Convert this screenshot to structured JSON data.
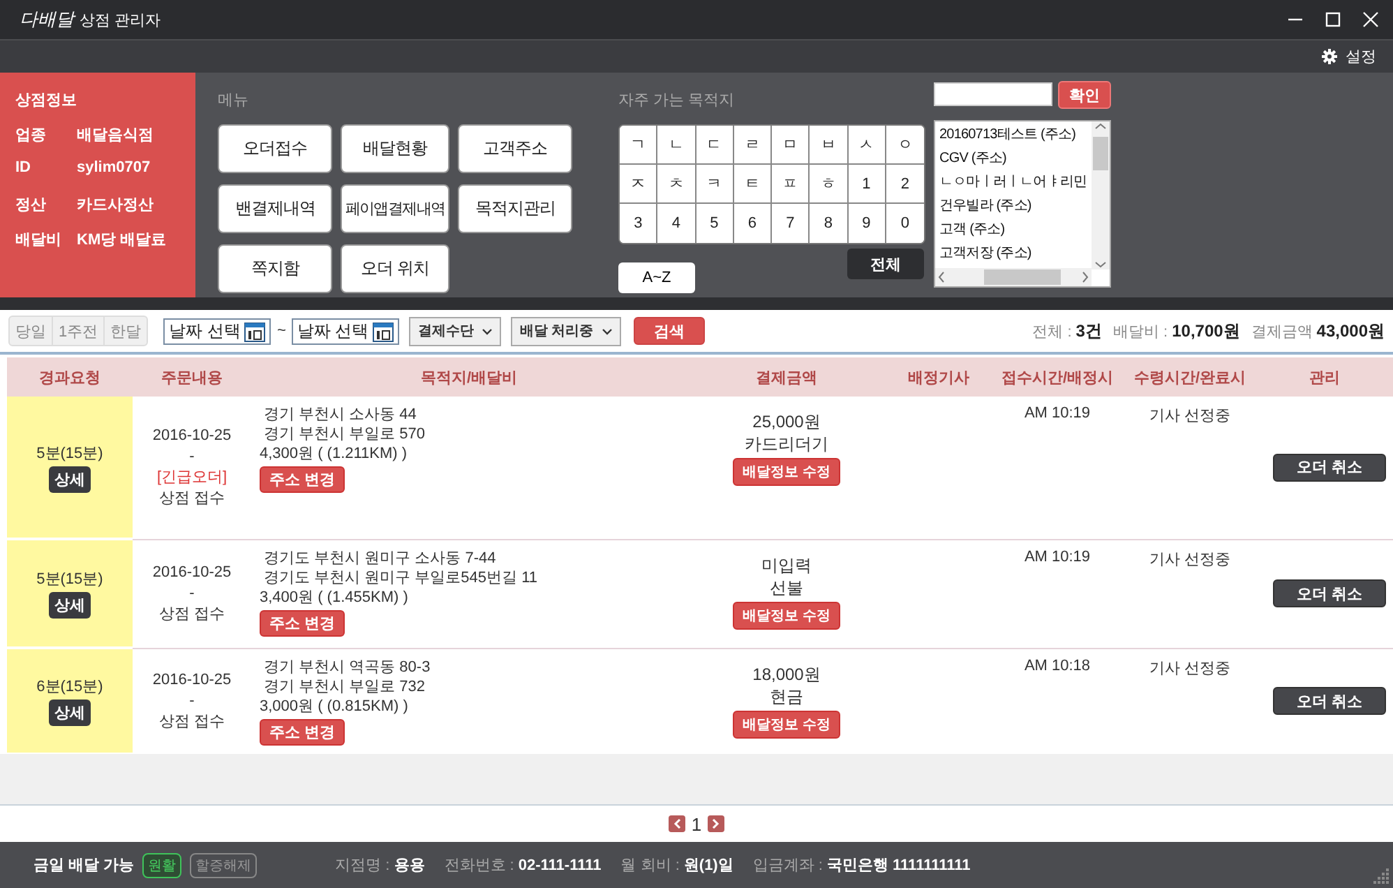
{
  "window": {
    "logo": "다배달",
    "title": "상점 관리자"
  },
  "toolbar": {
    "settings": "설정"
  },
  "store_info": {
    "title": "상점정보",
    "fields": [
      {
        "label": "업종",
        "value": "배달음식점"
      },
      {
        "label": "ID",
        "value": "sylim0707"
      },
      {
        "label": "정산",
        "value": "카드사정산"
      },
      {
        "label": "배달비",
        "value": "KM당 배달료"
      }
    ]
  },
  "menu": {
    "title": "메뉴",
    "buttons": [
      "오더접수",
      "배달현황",
      "고객주소",
      "밴결제내역",
      "페이앱결제내역",
      "목적지관리",
      "쪽지함",
      "오더 위치"
    ]
  },
  "destinations": {
    "title": "자주 가는 목적지",
    "keys": [
      "ㄱ",
      "ㄴ",
      "ㄷ",
      "ㄹ",
      "ㅁ",
      "ㅂ",
      "ㅅ",
      "ㅇ",
      "ㅈ",
      "ㅊ",
      "ㅋ",
      "ㅌ",
      "ㅍ",
      "ㅎ",
      "1",
      "2",
      "3",
      "4",
      "5",
      "6",
      "7",
      "8",
      "9",
      "0"
    ],
    "az_button": "A~Z",
    "all_button": "전체",
    "confirm_button": "확인",
    "list": [
      "20160713테스트 (주소)",
      "CGV (주소)",
      "ㄴㅇ마ㅣ러ㅣㄴ어ㅑ리민",
      "건우빌라 (주소)",
      "고객 (주소)",
      "고객저장 (주소)"
    ]
  },
  "filters": {
    "ranges": [
      "당일",
      "1주전",
      "한달"
    ],
    "date_from": {
      "placeholder": "날짜 선택"
    },
    "separator": "~",
    "date_to": {
      "placeholder": "날짜 선택"
    },
    "payment_select": "결제수단",
    "status_select": "배달 처리중",
    "search_button": "검색"
  },
  "summary": [
    {
      "label": "전체 :",
      "value": "3건"
    },
    {
      "label": "배달비 :",
      "value": "10,700원"
    },
    {
      "label": "결제금액",
      "value": "43,000원"
    }
  ],
  "table": {
    "columns": [
      "경과요청",
      "주문내용",
      "목적지/배달비",
      "결제금액",
      "배정기사",
      "접수시간/배정시",
      "수령시간/완료시",
      "관리"
    ],
    "rows": [
      {
        "elapsed": "5분(15분)",
        "detail_button": "상세",
        "date": "2016-10-25",
        "dash": "-",
        "tag": "[긴급오더]",
        "source": "상점 접수",
        "address_lines": [
          "경기 부천시 소사동 44",
          "경기 부천시 부일로 570"
        ],
        "fee": "4,300원 ( (1.211KM) )",
        "address_button": "주소 변경",
        "amount": "25,000원",
        "payment": "카드리더기",
        "edit_button": "배달정보 수정",
        "received": "AM 10:19",
        "pickup": "기사 선정중",
        "cancel_button": "오더 취소"
      },
      {
        "elapsed": "5분(15분)",
        "detail_button": "상세",
        "date": "2016-10-25",
        "dash": "-",
        "source": "상점 접수",
        "address_lines": [
          "경기도 부천시 원미구 소사동 7-44",
          "경기도 부천시 원미구 부일로545번길 11"
        ],
        "fee": "3,400원 ( (1.455KM) )",
        "address_button": "주소 변경",
        "amount": "미입력",
        "payment": "선불",
        "edit_button": "배달정보 수정",
        "received": "AM 10:19",
        "pickup": "기사 선정중",
        "cancel_button": "오더 취소"
      },
      {
        "elapsed": "6분(15분)",
        "detail_button": "상세",
        "date": "2016-10-25",
        "dash": "-",
        "source": "상점 접수",
        "address_lines": [
          "경기 부천시 역곡동 80-3",
          "경기 부천시 부일로 732"
        ],
        "fee": "3,000원 ( (0.815KM) )",
        "address_button": "주소 변경",
        "amount": "18,000원",
        "payment": "현금",
        "edit_button": "배달정보 수정",
        "received": "AM 10:18",
        "pickup": "기사 선정중",
        "cancel_button": "오더 취소"
      }
    ]
  },
  "pagination": {
    "page": "1"
  },
  "status_bar": {
    "availability": "금일 배달 가능",
    "badges": [
      {
        "label": "원활",
        "selected": true
      },
      {
        "label": "할증해제",
        "selected": false
      }
    ],
    "fields": [
      {
        "label": "지점명 :",
        "value": "용용"
      },
      {
        "label": "전화번호 :",
        "value": "02-111-1111"
      },
      {
        "label": "월 회비 :",
        "value": "원(1)일"
      },
      {
        "label": "입금계좌 :",
        "value": "국민은행 1111111111"
      }
    ]
  }
}
